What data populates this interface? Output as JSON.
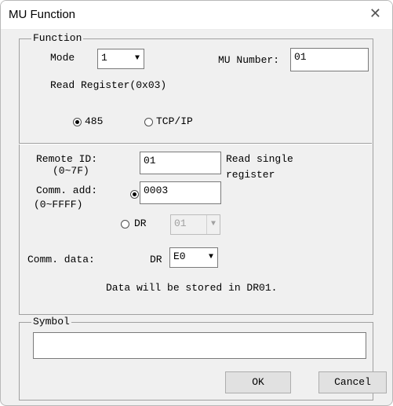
{
  "window": {
    "title": "MU Function",
    "close_glyph": "✕"
  },
  "function_group": {
    "legend": "Function",
    "mode_label": "Mode",
    "mode_value": "1",
    "mu_number_label": "MU Number:",
    "mu_number_value": "01",
    "read_register_text": "Read Register(0x03)",
    "radio_485": "485",
    "radio_tcpip": "TCP/IP",
    "remote_id_label": "Remote ID:",
    "remote_id_range": "(0~7F)",
    "remote_id_value": "01",
    "read_single_line1": "Read single",
    "read_single_line2": "register",
    "comm_add_label": "Comm. add:",
    "comm_add_range": "(0~FFFF)",
    "comm_add_value": "0003",
    "dr_label": "DR",
    "dr_value": "01",
    "comm_data_label": "Comm. data:",
    "comm_data_dr_label": "DR",
    "comm_data_value": "E0",
    "stored_note": "Data will be stored in DR01."
  },
  "symbol_group": {
    "legend": "Symbol",
    "value": ""
  },
  "buttons": {
    "ok": "OK",
    "cancel": "Cancel"
  },
  "icons": {
    "dropdown": "chevron-down-icon",
    "close": "close-icon"
  }
}
